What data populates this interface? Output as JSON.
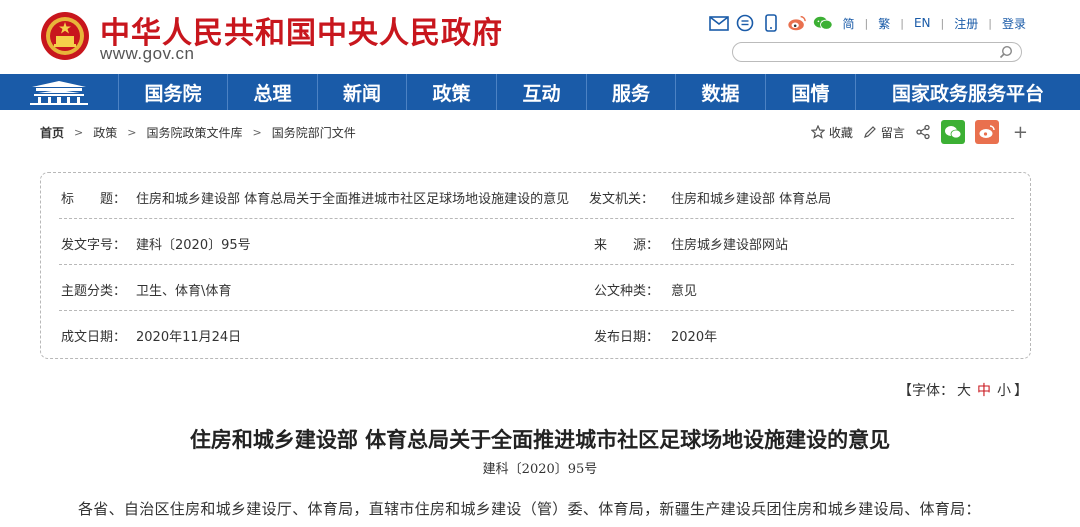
{
  "header": {
    "site_title": "中华人民共和国中央人民政府",
    "site_url": "www.gov.cn",
    "tools": [
      "mail-icon",
      "chat-icon",
      "mobile-icon",
      "weibo-icon",
      "wechat-icon"
    ],
    "languages": [
      "简",
      "繁",
      "EN"
    ],
    "register": "注册",
    "login": "登录",
    "search_placeholder": ""
  },
  "nav": {
    "items": [
      "国务院",
      "总理",
      "新闻",
      "政策",
      "互动",
      "服务",
      "数据",
      "国情",
      "国家政务服务平台"
    ]
  },
  "breadcrumb": [
    "首页",
    "政策",
    "国务院政策文件库",
    "国务院部门文件"
  ],
  "share": {
    "favorite": "收藏",
    "comment": "留言",
    "plus": "+"
  },
  "info": {
    "title_label": "标　　题：",
    "title_value": "住房和城乡建设部 体育总局关于全面推进城市社区足球场地设施建设的意见",
    "issuer_label": "发文机关：",
    "issuer_value": "住房和城乡建设部 体育总局",
    "docno_label": "发文字号：",
    "docno_value": "建科〔2020〕95号",
    "source_label": "来　　源：",
    "source_value": "住房城乡建设部网站",
    "topic_label": "主题分类：",
    "topic_value": "卫生、体育\\体育",
    "type_label": "公文种类：",
    "type_value": "意见",
    "date_label": "成文日期：",
    "date_value": "2020年11月24日",
    "pub_label": "发布日期：",
    "pub_value": "2020年"
  },
  "font_ctrl": {
    "prefix": "【字体：",
    "large": "大",
    "medium": "中",
    "small": "小",
    "suffix": "】"
  },
  "article": {
    "title": "住房和城乡建设部 体育总局关于全面推进城市社区足球场地设施建设的意见",
    "docno": "建科〔2020〕95号",
    "body_first": "各省、自治区住房和城乡建设厅、体育局，直辖市住房和城乡建设（管）委、体育局，新疆生产建设兵团住房和城乡建设局、体育局："
  },
  "colors": {
    "brand_red": "#c8161d",
    "nav_blue": "#1a5ba8",
    "wechat_green": "#3cb034",
    "weibo_orange": "#e9704e"
  }
}
